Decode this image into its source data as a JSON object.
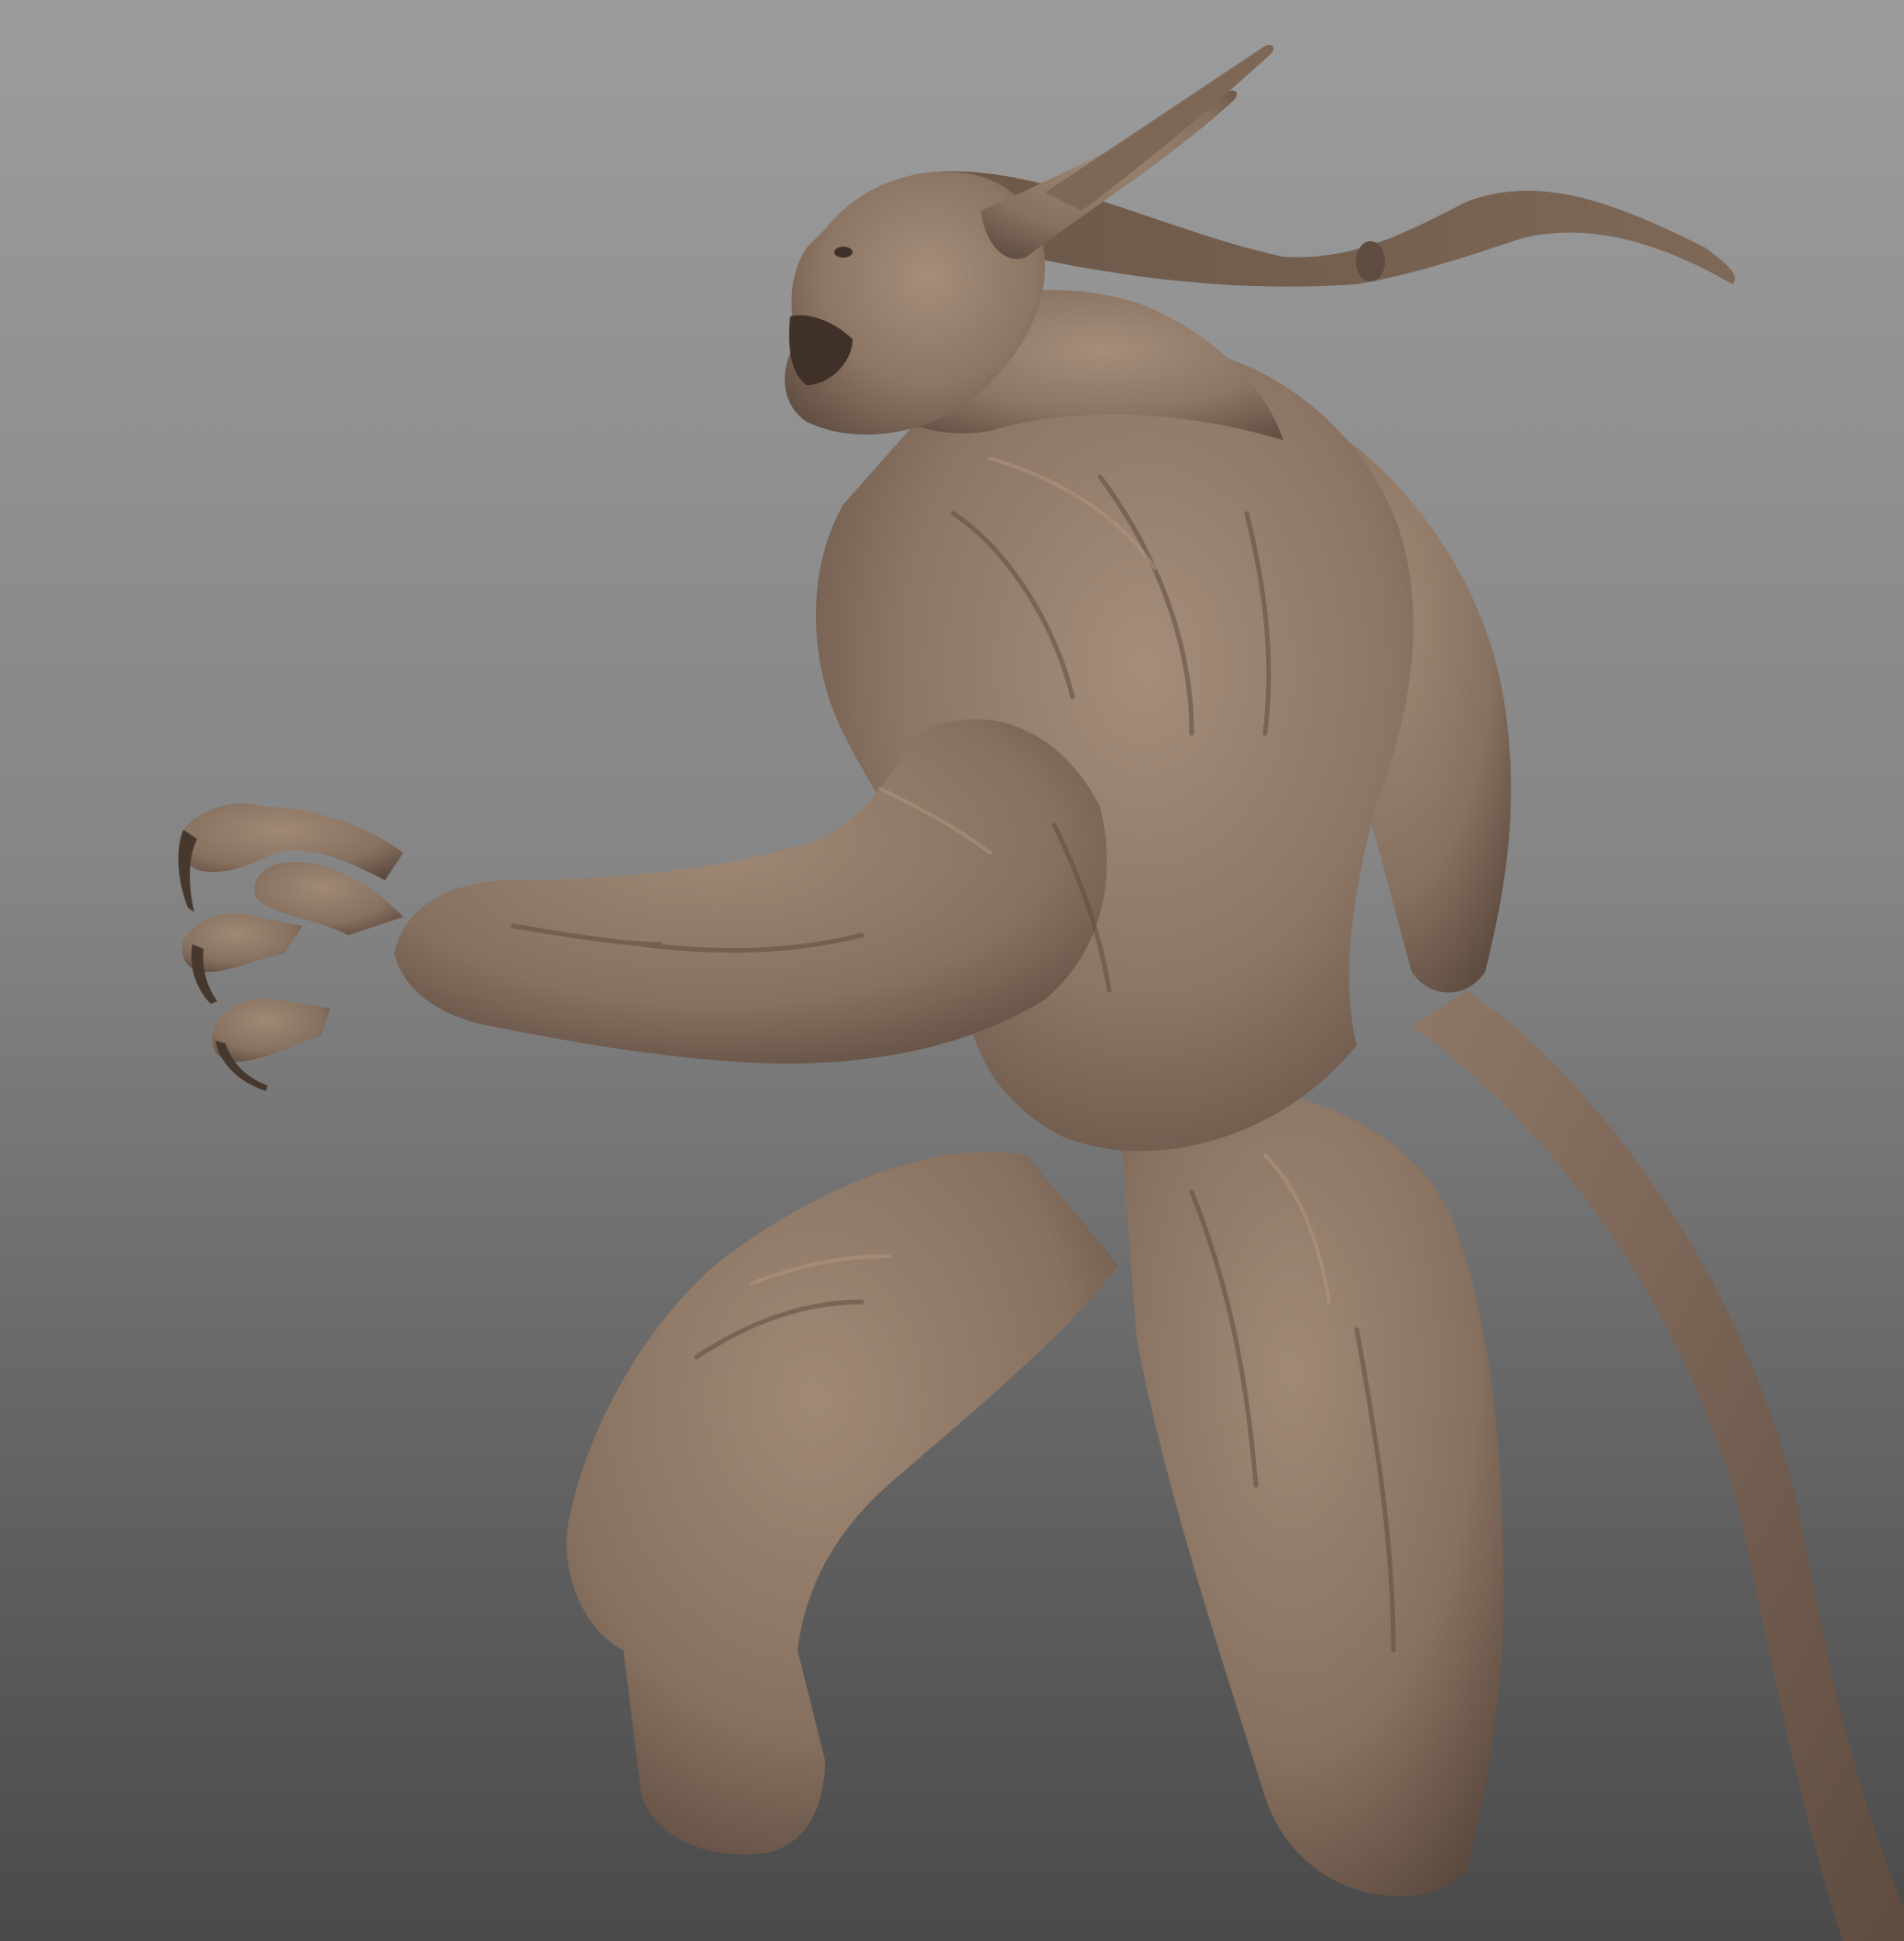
{
  "scene": {
    "subject": "sculpted-creature-model",
    "colors": {
      "background_top": "#9c9c9c",
      "background_bottom": "#4a4a4a",
      "clay_base": "#8c7564",
      "clay_light": "#a58d7a",
      "clay_shadow": "#5e4c40",
      "clay_deep": "#47382e"
    }
  }
}
